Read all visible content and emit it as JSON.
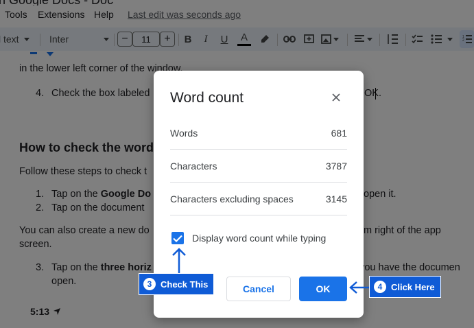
{
  "app": {
    "title_partial": "n Google Docs - Doc"
  },
  "menu": {
    "items": [
      "Tools",
      "Extensions",
      "Help"
    ],
    "last_edit": "Last edit was seconds ago"
  },
  "toolbar": {
    "style_label": "l text",
    "font_label": "Inter",
    "font_size": "11",
    "minus": "−",
    "plus": "+",
    "bold": "B",
    "italic": "I",
    "underline": "U",
    "text_color": "A"
  },
  "document": {
    "line1": "in the lower left corner of the window.",
    "line2_num": "4.",
    "line2": "Check the box labeled",
    "line2_end": "OK.",
    "heading": "How to check the word",
    "para1": "Follow these steps to check t",
    "list1_num": "1.",
    "list1_pre": "Tap on the ",
    "list1_bold": "Google Do",
    "list1_end": "open it.",
    "list2_num": "2.",
    "list2": "Tap on the document",
    "para2": "You can also create a new do",
    "para2_end": "m right of the app",
    "para2_line2": "screen.",
    "list3_num": "3.",
    "list3_pre": "Tap on the ",
    "list3_bold": "three horiz",
    "list3_end": "n you have the documen",
    "list3_line2": "open.",
    "time": "5:13"
  },
  "dialog": {
    "title": "Word count",
    "rows": [
      {
        "label": "Words",
        "value": "681"
      },
      {
        "label": "Characters",
        "value": "3787"
      },
      {
        "label": "Characters excluding spaces",
        "value": "3145"
      }
    ],
    "checkbox_label": "Display word count while typing",
    "checkbox_checked": true,
    "cancel_label": "Cancel",
    "ok_label": "OK"
  },
  "annotations": [
    {
      "number": "3",
      "text": "Check This"
    },
    {
      "number": "4",
      "text": "Click Here"
    }
  ],
  "colors": {
    "accent": "#1a73e8",
    "callout": "#0f5bd6",
    "toolbar_bg": "#edf2fa"
  }
}
